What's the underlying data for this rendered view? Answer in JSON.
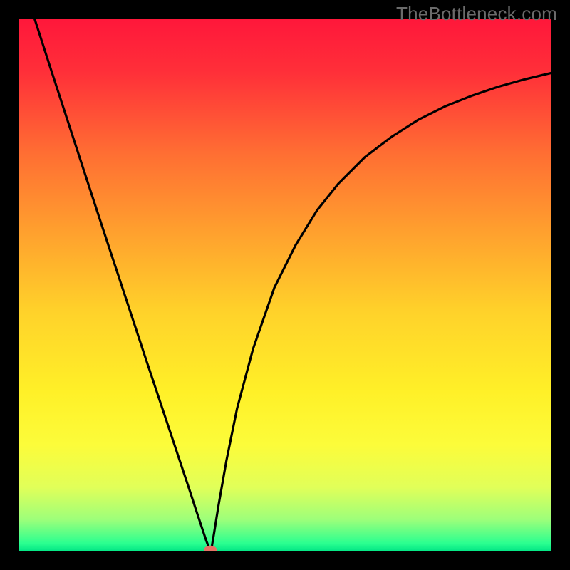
{
  "watermark": "TheBottleneck.com",
  "chart_data": {
    "type": "line",
    "title": "",
    "xlabel": "",
    "ylabel": "",
    "xlim": [
      0,
      1
    ],
    "ylim": [
      0,
      1
    ],
    "background_gradient": {
      "stops": [
        {
          "pos": 0.0,
          "color": "#ff173a"
        },
        {
          "pos": 0.1,
          "color": "#ff2f39"
        },
        {
          "pos": 0.25,
          "color": "#ff6d33"
        },
        {
          "pos": 0.4,
          "color": "#ffa02e"
        },
        {
          "pos": 0.55,
          "color": "#ffd22a"
        },
        {
          "pos": 0.7,
          "color": "#fff028"
        },
        {
          "pos": 0.8,
          "color": "#fcfc3a"
        },
        {
          "pos": 0.88,
          "color": "#e1ff59"
        },
        {
          "pos": 0.94,
          "color": "#9dff7a"
        },
        {
          "pos": 0.985,
          "color": "#2aff90"
        },
        {
          "pos": 1.0,
          "color": "#00e484"
        }
      ]
    },
    "series": [
      {
        "name": "bottleneck-curve",
        "color": "#000000",
        "x": [
          0.03,
          0.06,
          0.09,
          0.12,
          0.15,
          0.18,
          0.21,
          0.24,
          0.27,
          0.3,
          0.32,
          0.335,
          0.345,
          0.352,
          0.357,
          0.36,
          0.363,
          0.367,
          0.375,
          0.39,
          0.41,
          0.44,
          0.48,
          0.52,
          0.56,
          0.6,
          0.65,
          0.7,
          0.75,
          0.8,
          0.85,
          0.9,
          0.95,
          1.0
        ],
        "y": [
          1.0,
          0.907,
          0.815,
          0.723,
          0.631,
          0.54,
          0.449,
          0.358,
          0.268,
          0.178,
          0.118,
          0.072,
          0.042,
          0.021,
          0.008,
          0.0,
          0.011,
          0.035,
          0.085,
          0.17,
          0.268,
          0.38,
          0.495,
          0.575,
          0.64,
          0.69,
          0.74,
          0.778,
          0.81,
          0.835,
          0.855,
          0.872,
          0.886,
          0.898
        ]
      }
    ],
    "marker": {
      "name": "optimum-point",
      "x": 0.36,
      "y": 0.003,
      "rx": 0.012,
      "ry": 0.008,
      "color": "#e57265"
    }
  }
}
